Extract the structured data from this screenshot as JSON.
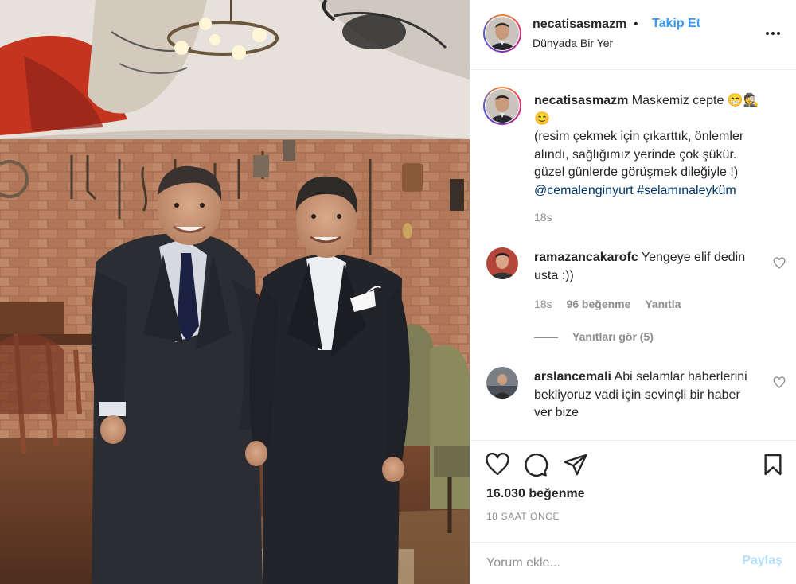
{
  "post": {
    "username": "necatisasmazm",
    "separator": "•",
    "follow_label": "Takip Et",
    "location": "Dünyada Bir Yer",
    "more_icon": "more-horizontal-icon",
    "photo_alt": "Two men in dark suits posing in a restaurant"
  },
  "caption": {
    "username": "necatisasmazm",
    "line1": "Maskemiz cepte 😁🕵️",
    "line2": "😊",
    "line3": "(resim çekmek için çıkarttık, önlemler alındı, sağlığımız yerinde çok şükür.",
    "line4": "güzel günlerde görüşmek dileğiyle !)",
    "mention": "@cemalenginyurt",
    "hashtag": "#selamınaleyküm",
    "time": "18s"
  },
  "comments": [
    {
      "username": "ramazancakarofc",
      "text": "Yengeye elif dedin usta :))",
      "time": "18s",
      "likes": "96 beğenme",
      "reply": "Yanıtla",
      "view_replies": "Yanıtları gör (5)"
    },
    {
      "username": "arslancemali",
      "text": "Abi selamlar haberlerini bekliyoruz vadi için sevinçli bir haber ver bize"
    }
  ],
  "actions": {
    "like_icon": "heart-icon",
    "comment_icon": "comment-icon",
    "share_icon": "send-icon",
    "save_icon": "bookmark-icon",
    "likes_count": "16.030 beğenme",
    "posted_ago": "18 SAAT ÖNCE"
  },
  "add_comment": {
    "placeholder": "Yorum ekle...",
    "submit_label": "Paylaş"
  },
  "colors": {
    "link_blue": "#3897f0",
    "hashtag_blue": "#00376b",
    "muted": "#8e8e8e",
    "submit_disabled": "#b2dffc"
  }
}
